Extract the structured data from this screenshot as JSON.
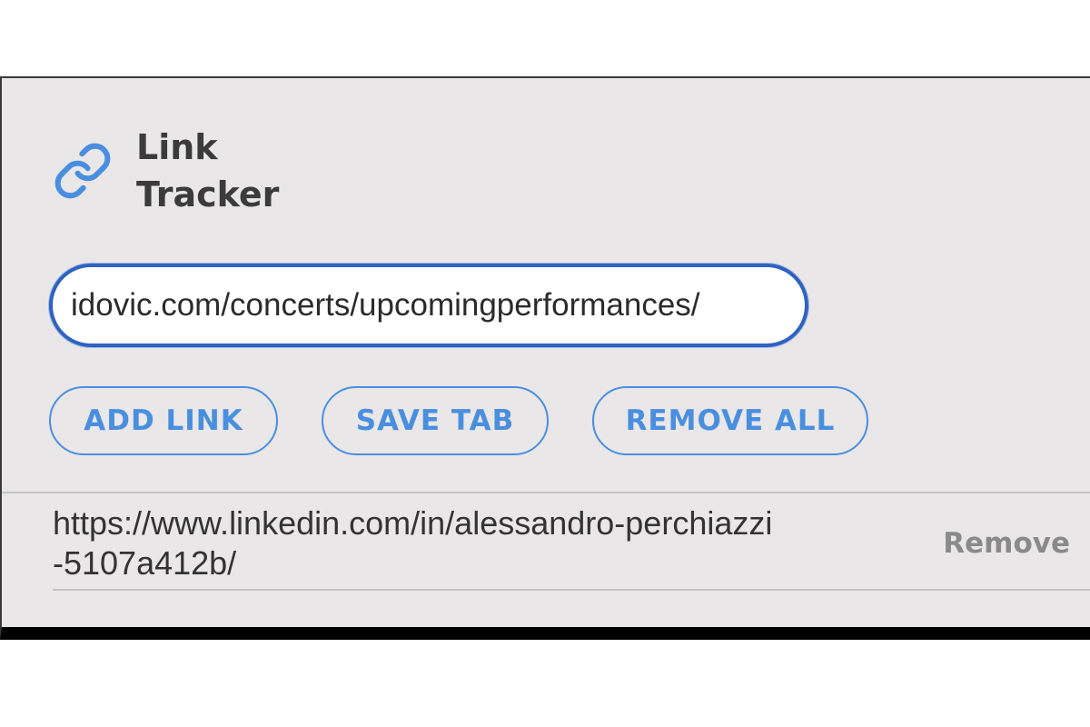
{
  "header": {
    "title_line1": "Link",
    "title_line2": "Tracker",
    "icon": "link-icon"
  },
  "input": {
    "value": "idovic.com/concerts/upcomingperformances/"
  },
  "buttons": {
    "add_link": "ADD LINK",
    "save_tab": "SAVE TAB",
    "remove_all": "REMOVE ALL"
  },
  "links": [
    {
      "url": "https://www.linkedin.com/in/alessandro-perchiazzi-5107a412b/",
      "remove_label": "Remove"
    }
  ],
  "colors": {
    "accent": "#4a8fdf",
    "input_border": "#2f62c0",
    "background": "#e9e7e8",
    "title_text": "#3b3b3b",
    "muted": "#8a8a8a"
  }
}
